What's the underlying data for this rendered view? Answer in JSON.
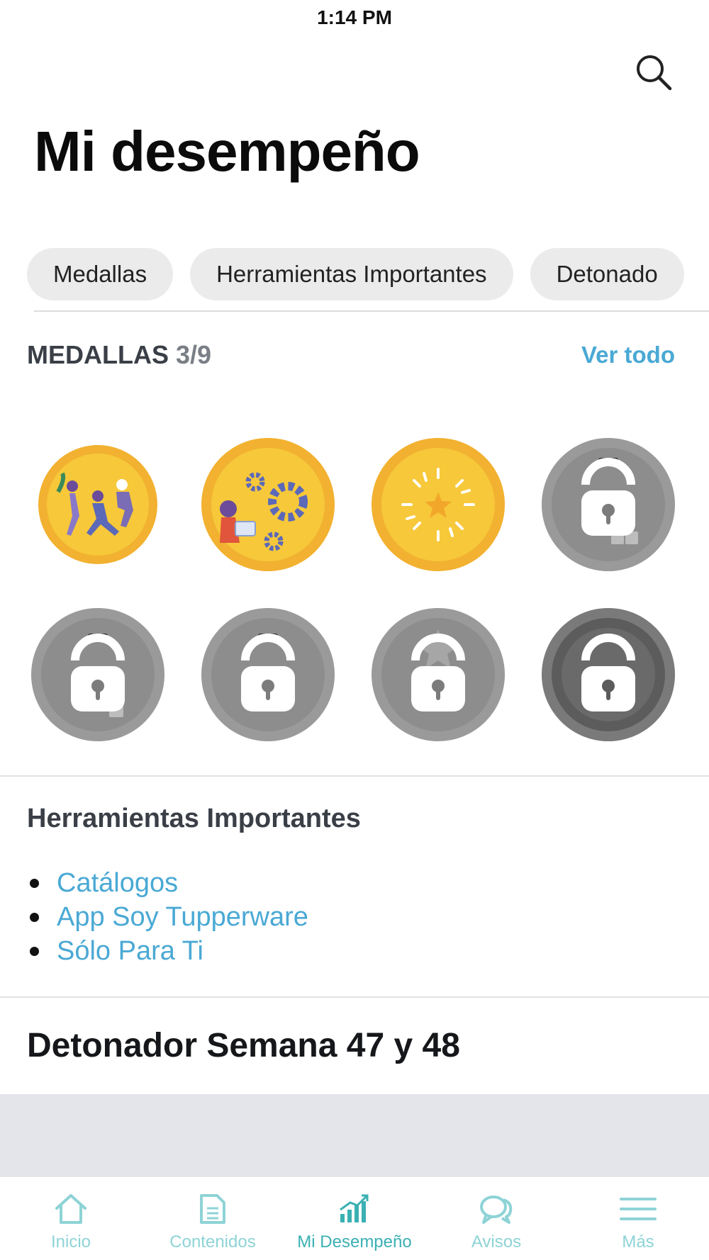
{
  "status_bar": {
    "time": "1:14 PM"
  },
  "header": {
    "search_icon": "search-icon",
    "title": "Mi desempeño"
  },
  "chips": [
    {
      "label": "Medallas"
    },
    {
      "label": "Herramientas Importantes"
    },
    {
      "label": "Detonado"
    }
  ],
  "medals": {
    "title": "MEDALLAS",
    "count": "3/9",
    "see_all": "Ver todo",
    "earned": 3,
    "total": 9,
    "items": [
      {
        "state": "unlocked",
        "icon": "people-jumping-icon"
      },
      {
        "state": "unlocked",
        "icon": "gears-icon"
      },
      {
        "state": "unlocked",
        "icon": "star-burst-icon"
      },
      {
        "state": "locked",
        "icon": "lock-icon"
      },
      {
        "state": "locked",
        "icon": "lock-icon"
      },
      {
        "state": "locked",
        "icon": "lock-icon"
      },
      {
        "state": "locked",
        "icon": "lock-icon"
      },
      {
        "state": "locked",
        "icon": "lock-icon"
      }
    ]
  },
  "tools": {
    "title": "Herramientas Importantes",
    "links": [
      {
        "label": "Catálogos"
      },
      {
        "label": "App Soy Tupperware"
      },
      {
        "label": "Sólo Para Ti"
      }
    ]
  },
  "detonador": {
    "title": "Detonador Semana 47 y 48"
  },
  "bottom_nav": [
    {
      "label": "Inicio",
      "icon": "home-icon",
      "active": false
    },
    {
      "label": "Contenidos",
      "icon": "document-icon",
      "active": false
    },
    {
      "label": "Mi Desempeño",
      "icon": "chart-icon",
      "active": true
    },
    {
      "label": "Avisos",
      "icon": "chat-bubbles-icon",
      "active": false
    },
    {
      "label": "Más",
      "icon": "menu-icon",
      "active": false
    }
  ],
  "colors": {
    "accent_link": "#4aa9d4",
    "nav_active": "#3bb0b3",
    "nav_inactive": "#8ed3d6",
    "medal_gold": "#f6c83a",
    "medal_gold_rim": "#f2b130",
    "medal_locked": "#8d8d8d"
  }
}
